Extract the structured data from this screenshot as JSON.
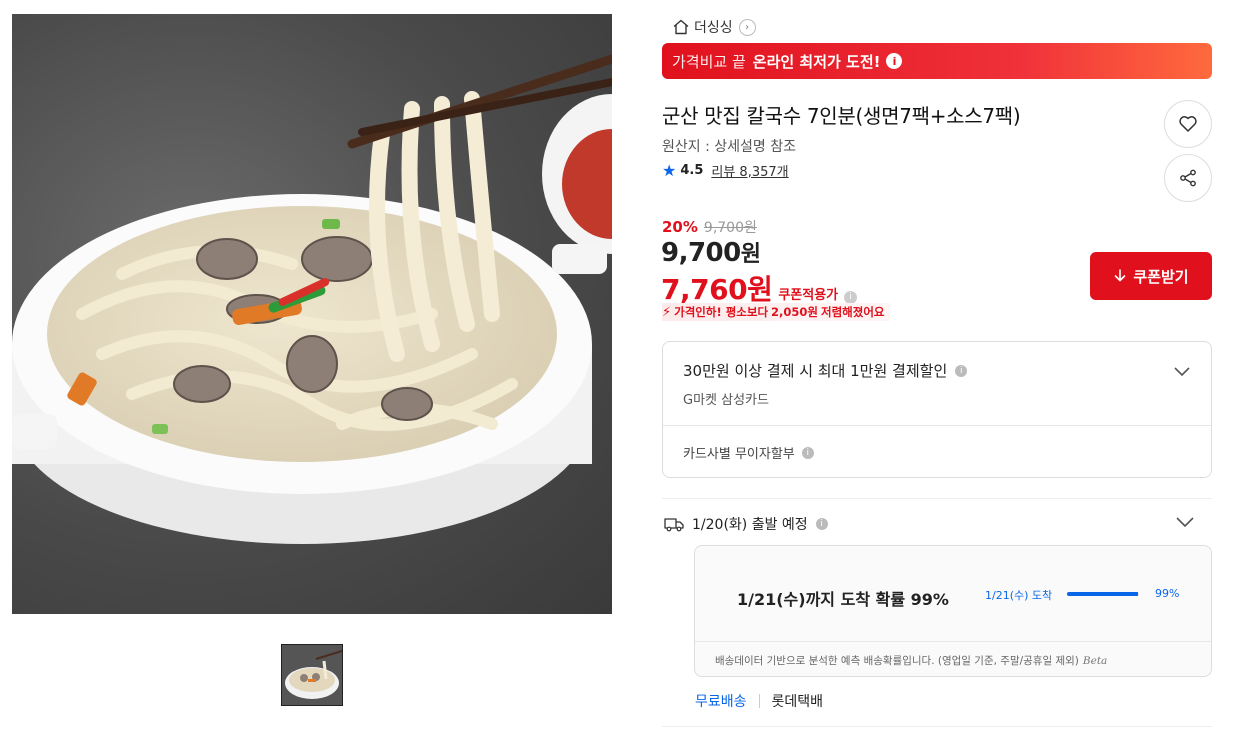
{
  "store": {
    "name": "더싱싱"
  },
  "promo": {
    "prefix": "가격비교 끝",
    "highlight": "온라인 최저가 도전!"
  },
  "product": {
    "title": "군산 맛집 칼국수 7인분(생면7팩+소스7팩)",
    "origin": "원산지 : 상세설명 참조",
    "rating": "4.5",
    "review_label": "리뷰 8,357개"
  },
  "pricing": {
    "discount_rate": "20%",
    "original_price": "9,700원",
    "price": "9,700",
    "price_unit": "원",
    "coupon_price": "7,760",
    "coupon_price_unit": "원",
    "coupon_label": "쿠폰적용가",
    "price_drop_prefix": "가격인하! 평소보다",
    "price_drop_amount": "2,050원",
    "price_drop_suffix": "저렴해졌어요",
    "coupon_button": "쿠폰받기"
  },
  "card_benefit": {
    "title": "30만원 이상 결제 시 최대 1만원 결제할인",
    "sub": "G마켓 삼성카드",
    "installment": "카드사별 무이자할부"
  },
  "shipping": {
    "departure": "1/20(화) 출발 예정",
    "arrival_probability": "1/21(수)까지 도착 확률 99%",
    "bar_label": "1/21(수) 도착",
    "bar_percent": "99%",
    "bar_value": 0.99,
    "note": "배송데이터 기반으로 분석한 예측 배송확률입니다. (영업일 기준, 주말/공휴일 제외)",
    "beta": "Beta",
    "free": "무료배송",
    "carrier": "롯데택배"
  },
  "icons": {
    "home": "home-icon",
    "heart": "heart-icon",
    "share": "share-icon",
    "star": "star-icon",
    "truck": "truck-icon",
    "download": "download-icon"
  },
  "colors": {
    "accent_red": "#e0111d",
    "accent_blue": "#0a66e8"
  }
}
